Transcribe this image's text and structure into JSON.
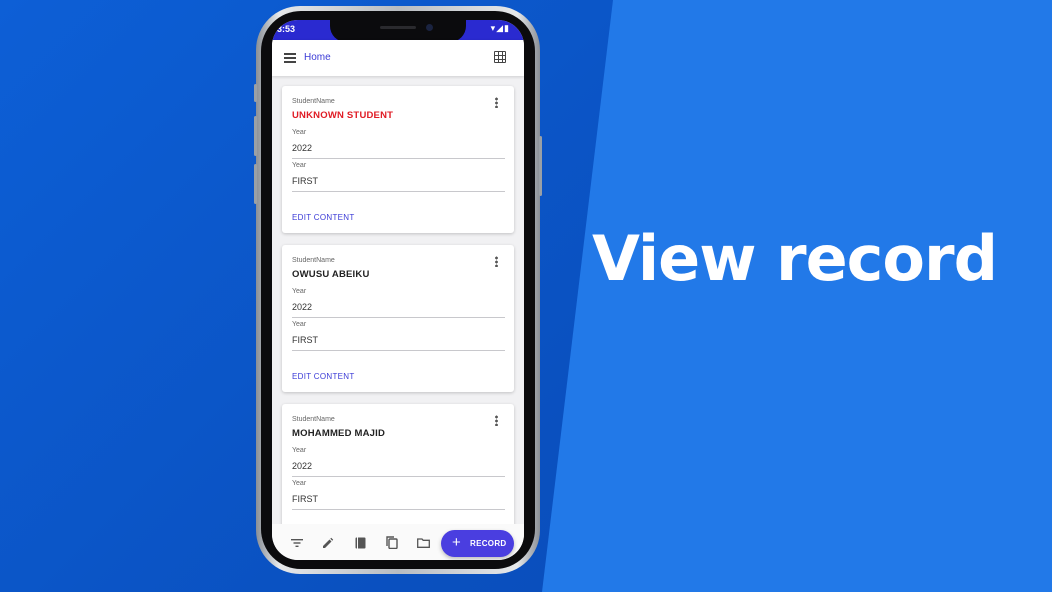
{
  "headline": "View record",
  "status_bar": {
    "time": "3:53",
    "icons_text": "▾◢▮"
  },
  "app_bar": {
    "title": "Home"
  },
  "records": [
    {
      "name_label": "StudentName",
      "name": "UNKNOWN STUDENT",
      "year_label": "Year",
      "year": "2022",
      "level_label": "Year",
      "level": "FIRST",
      "action": "EDIT CONTENT"
    },
    {
      "name_label": "StudentName",
      "name": "OWUSU ABEIKU",
      "year_label": "Year",
      "year": "2022",
      "level_label": "Year",
      "level": "FIRST",
      "action": "EDIT CONTENT"
    },
    {
      "name_label": "StudentName",
      "name": "MOHAMMED MAJID",
      "year_label": "Year",
      "year": "2022",
      "level_label": "Year",
      "level": "FIRST"
    }
  ],
  "bottom_bar": {
    "icons": [
      "filter-icon",
      "pencil-icon",
      "book-icon",
      "copy-icon",
      "folder-icon"
    ],
    "fab_label": "RECORD"
  },
  "colors": {
    "accent": "#4a3ee0",
    "warning_name": "#e01b24",
    "background_left": "#0a50bf",
    "background_right": "#2279e8"
  }
}
